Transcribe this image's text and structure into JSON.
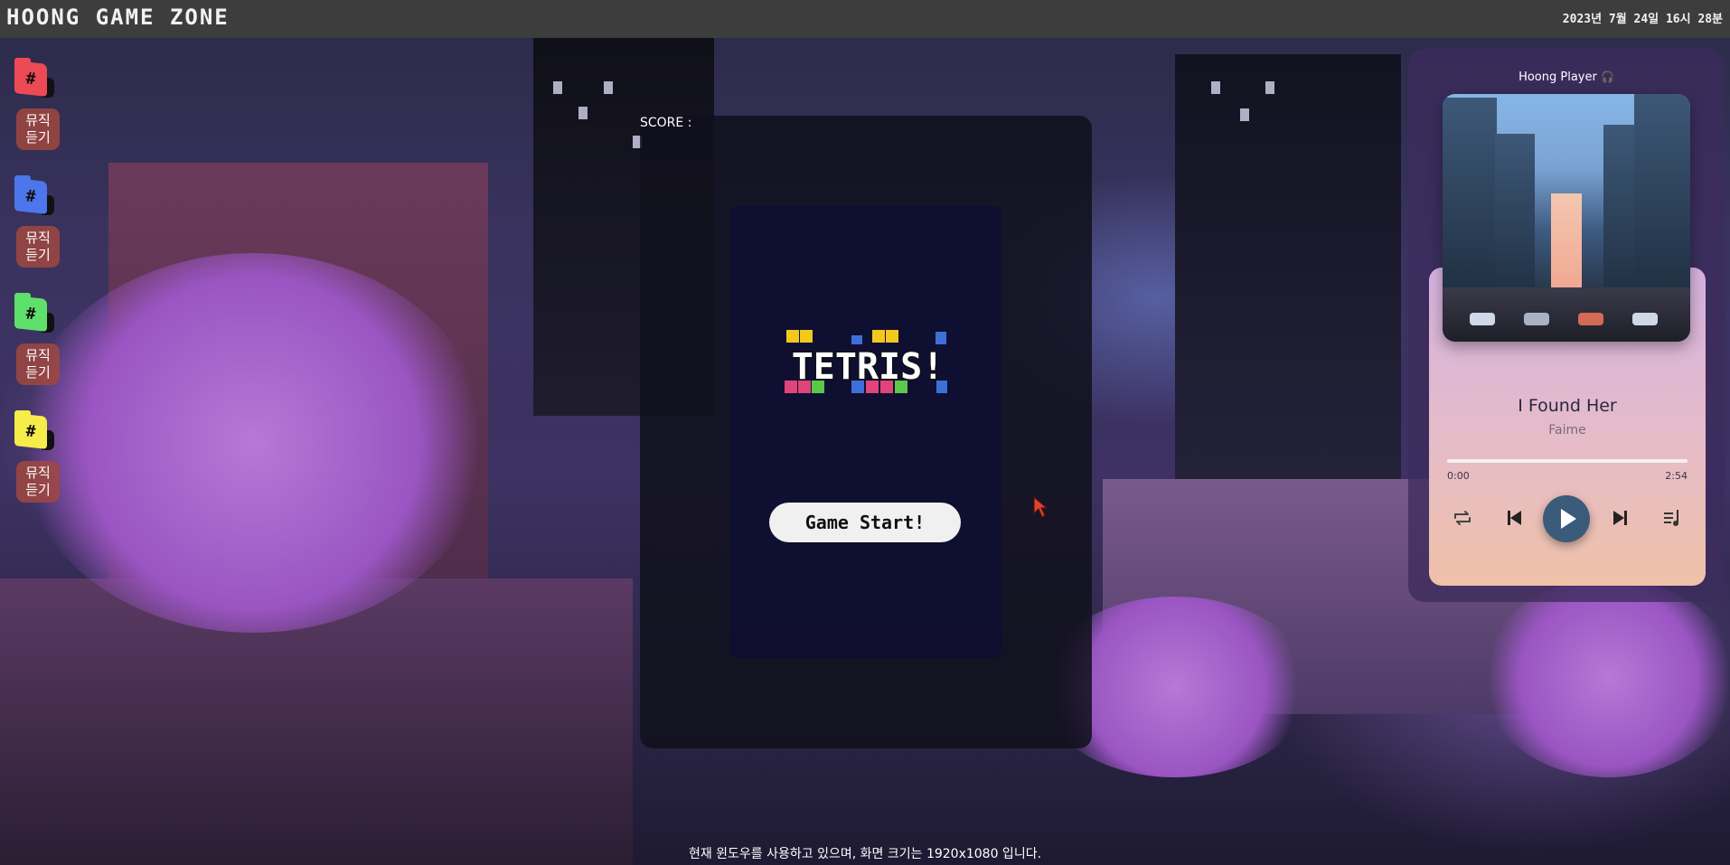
{
  "app": {
    "title": "HOONG GAME ZONE",
    "clock": "2023년 7월 24일 16시 28분"
  },
  "sidebar": {
    "items": [
      {
        "folder_glyph": "#",
        "folder_color": "#ec4b55",
        "button_line1": "뮤직",
        "button_line2": "듣기"
      },
      {
        "folder_glyph": "#",
        "folder_color": "#4d76ec",
        "button_line1": "뮤직",
        "button_line2": "듣기"
      },
      {
        "folder_glyph": "#",
        "folder_color": "#5fe06a",
        "button_line1": "뮤직",
        "button_line2": "듣기"
      },
      {
        "folder_glyph": "#",
        "folder_color": "#f6ec4a",
        "button_line1": "뮤직",
        "button_line2": "듣기"
      }
    ]
  },
  "game": {
    "score_label": "SCORE :",
    "score_value": "",
    "logo_text": "TETRIS!",
    "start_label": "Game Start!"
  },
  "player": {
    "title": "Hoong Player",
    "title_icon": "headphones-icon",
    "song_title": "I Found Her",
    "artist": "Faime",
    "current_time": "0:00",
    "total_time": "2:54",
    "progress": 0,
    "controls": [
      "repeat-icon",
      "previous-icon",
      "play-icon",
      "next-icon",
      "playlist-icon"
    ]
  },
  "footer": {
    "message": "현재 윈도우를 사용하고 있으며, 화면 크기는 1920x1080 입니다."
  },
  "colors": {
    "topbar": "#3d3d3d",
    "music_button": "#a04840",
    "play_button": "#3b5b7a"
  }
}
